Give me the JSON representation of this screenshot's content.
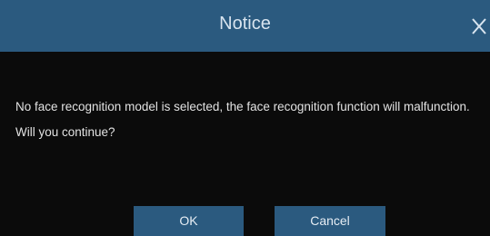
{
  "dialog": {
    "title": "Notice",
    "close_icon": "close-icon",
    "message": "No face recognition model is selected, the face recognition function will malfunction. Will you continue?",
    "ok_label": "OK",
    "cancel_label": "Cancel"
  },
  "colors": {
    "titlebar": "#2b5a7f",
    "button": "#2b5a7f",
    "background": "#0b0b0b",
    "text": "#e2e2e2"
  }
}
